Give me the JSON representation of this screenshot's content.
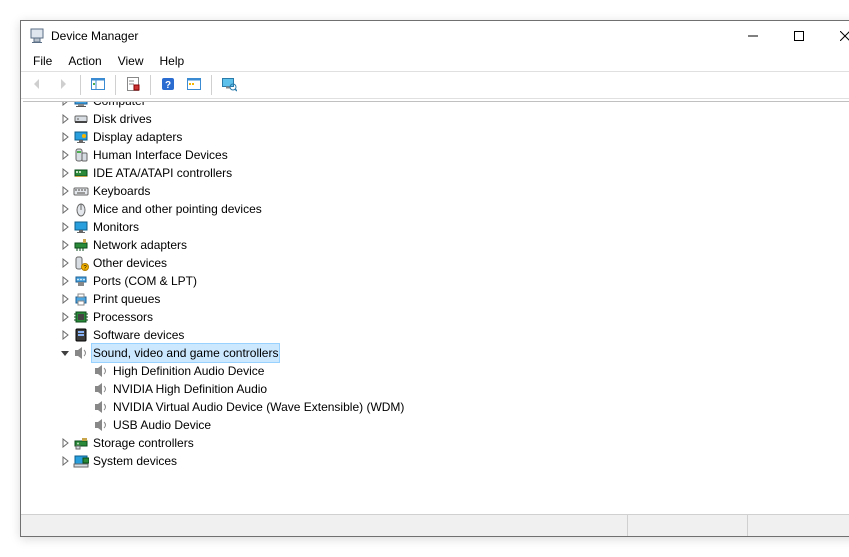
{
  "window": {
    "title": "Device Manager"
  },
  "menu": {
    "items": [
      "File",
      "Action",
      "View",
      "Help"
    ]
  },
  "tree": {
    "nodes": [
      {
        "label": "Computer",
        "expanded": false,
        "iconKey": "computer"
      },
      {
        "label": "Disk drives",
        "expanded": false,
        "iconKey": "disk"
      },
      {
        "label": "Display adapters",
        "expanded": false,
        "iconKey": "display"
      },
      {
        "label": "Human Interface Devices",
        "expanded": false,
        "iconKey": "hid"
      },
      {
        "label": "IDE ATA/ATAPI controllers",
        "expanded": false,
        "iconKey": "ide"
      },
      {
        "label": "Keyboards",
        "expanded": false,
        "iconKey": "keyboard"
      },
      {
        "label": "Mice and other pointing devices",
        "expanded": false,
        "iconKey": "mouse"
      },
      {
        "label": "Monitors",
        "expanded": false,
        "iconKey": "monitor"
      },
      {
        "label": "Network adapters",
        "expanded": false,
        "iconKey": "network"
      },
      {
        "label": "Other devices",
        "expanded": false,
        "iconKey": "other"
      },
      {
        "label": "Ports (COM & LPT)",
        "expanded": false,
        "iconKey": "port"
      },
      {
        "label": "Print queues",
        "expanded": false,
        "iconKey": "printer"
      },
      {
        "label": "Processors",
        "expanded": false,
        "iconKey": "cpu"
      },
      {
        "label": "Software devices",
        "expanded": false,
        "iconKey": "software"
      },
      {
        "label": "Sound, video and game controllers",
        "expanded": true,
        "selected": true,
        "iconKey": "sound",
        "children": [
          {
            "label": "High Definition Audio Device",
            "iconKey": "speaker"
          },
          {
            "label": "NVIDIA High Definition Audio",
            "iconKey": "speaker"
          },
          {
            "label": "NVIDIA Virtual Audio Device (Wave Extensible) (WDM)",
            "iconKey": "speaker"
          },
          {
            "label": "USB Audio Device",
            "iconKey": "speaker"
          }
        ]
      },
      {
        "label": "Storage controllers",
        "expanded": false,
        "iconKey": "storage"
      },
      {
        "label": "System devices",
        "expanded": false,
        "iconKey": "system"
      }
    ]
  }
}
